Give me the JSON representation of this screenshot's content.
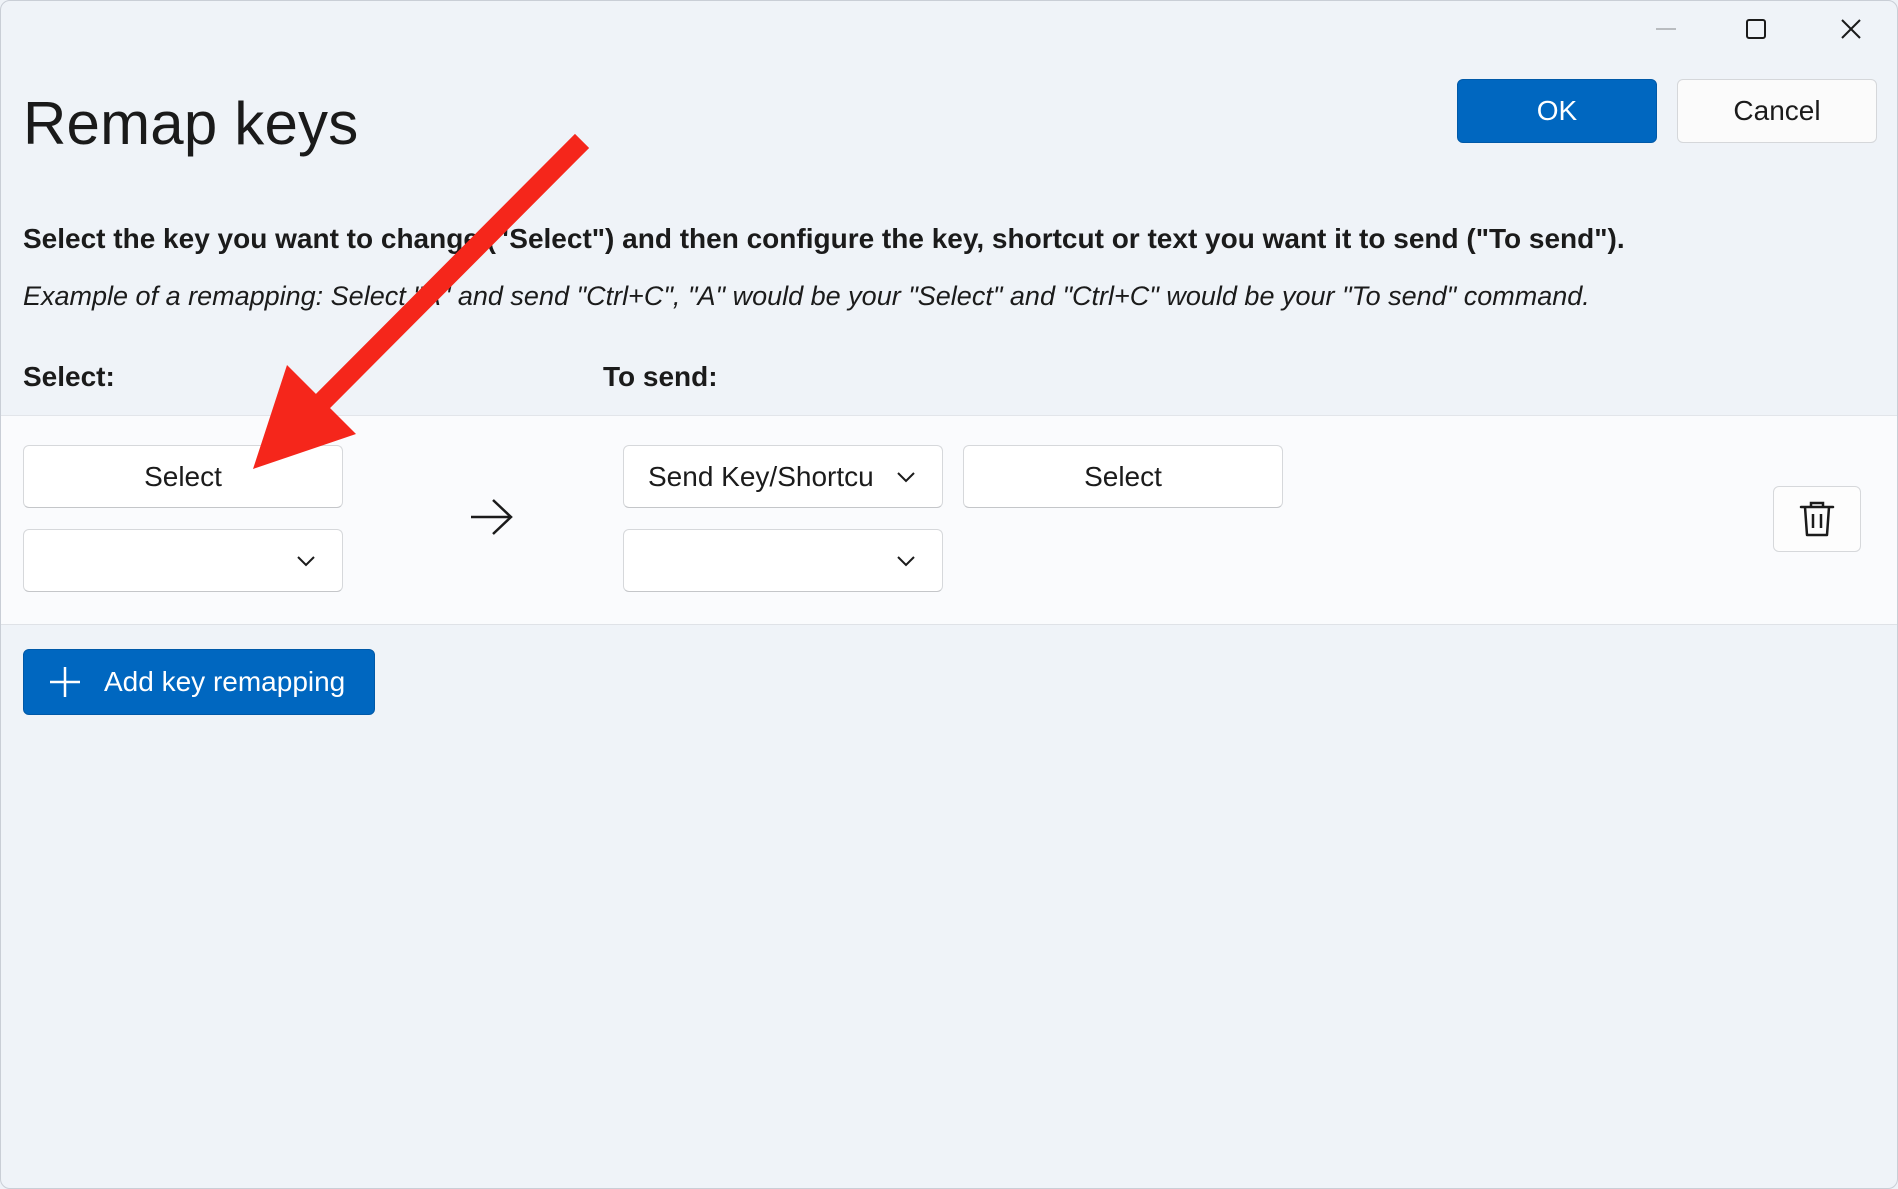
{
  "window": {
    "title": "Remap keys"
  },
  "header": {
    "ok_label": "OK",
    "cancel_label": "Cancel"
  },
  "description": "Select the key you want to change (\"Select\") and then configure the key, shortcut or text you want it to send (\"To send\").",
  "example": "Example of a remapping: Select \"A\" and send \"Ctrl+C\", \"A\" would be your \"Select\" and \"Ctrl+C\" would be your \"To send\" command.",
  "columns": {
    "select_label": "Select:",
    "to_send_label": "To send:"
  },
  "remapping_row": {
    "select_button_label": "Select",
    "select_dropdown_value": "",
    "send_type_value": "Send Key/Shortcu",
    "to_send_button_label": "Select",
    "send_dropdown_value": ""
  },
  "add_button_label": "Add key remapping",
  "icons": {
    "minimize": "minimize-icon",
    "maximize": "maximize-icon",
    "close": "close-icon",
    "chevron": "chevron-down-icon",
    "arrow": "arrow-right-icon",
    "delete": "trash-icon",
    "add": "plus-icon"
  },
  "colors": {
    "accent": "#0067c0",
    "annotation": "#f5261b",
    "background": "#eff3f8"
  }
}
